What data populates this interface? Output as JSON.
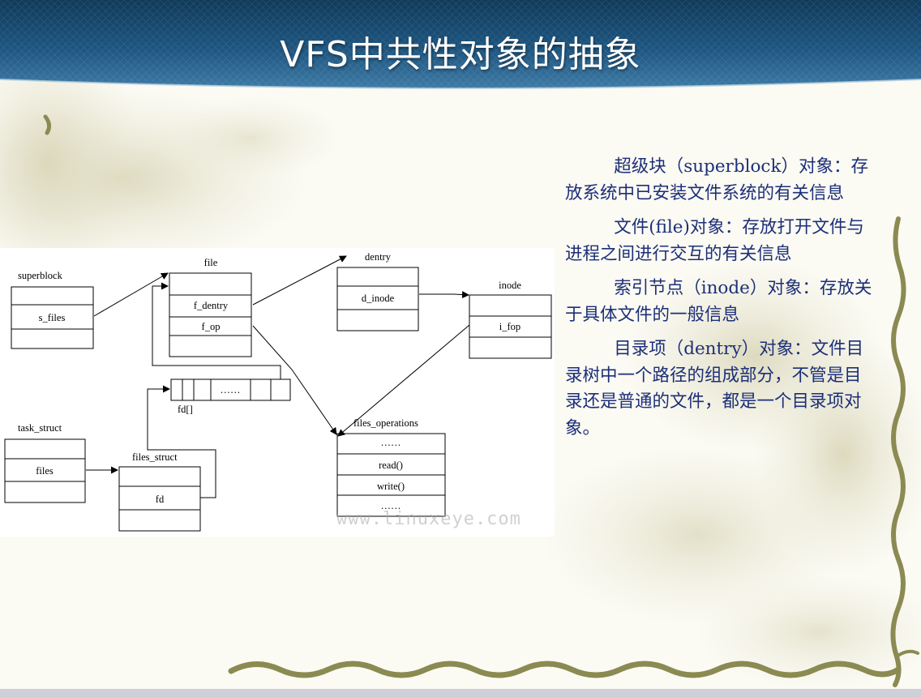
{
  "slide": {
    "title": "VFS中共性对象的抽象",
    "watermark": "www.linuxeye.com",
    "paragraphs": [
      "超级块（superblock）对象：存放系统中已安装文件系统的有关信息",
      "文件(file)对象：存放打开文件与进程之间进行交互的有关信息",
      "索引节点（inode）对象：存放关于具体文件的一般信息",
      "目录项（dentry）对象：文件目录树中一个路径的组成部分，不管是目录还是普通的文件，都是一个目录项对象。"
    ]
  },
  "diagram": {
    "superblock": {
      "label": "superblock",
      "field": "s_files"
    },
    "file": {
      "label": "file",
      "fields": [
        "f_dentry",
        "f_op"
      ]
    },
    "dentry": {
      "label": "dentry",
      "field": "d_inode"
    },
    "inode": {
      "label": "inode",
      "field": "i_fop"
    },
    "fd_array": {
      "label": "fd[]",
      "ellipsis": "……"
    },
    "task_struct": {
      "label": "task_struct",
      "field": "files"
    },
    "files_struct": {
      "label": "files_struct",
      "field": "fd"
    },
    "files_operations": {
      "label": "files_operations",
      "fields": [
        "……",
        "read()",
        "write()",
        "……"
      ]
    }
  },
  "colors": {
    "title_text": "#ffffff",
    "banner": "#1d4a72",
    "body_text": "#1c2f78",
    "vine": "#8a8a52"
  }
}
